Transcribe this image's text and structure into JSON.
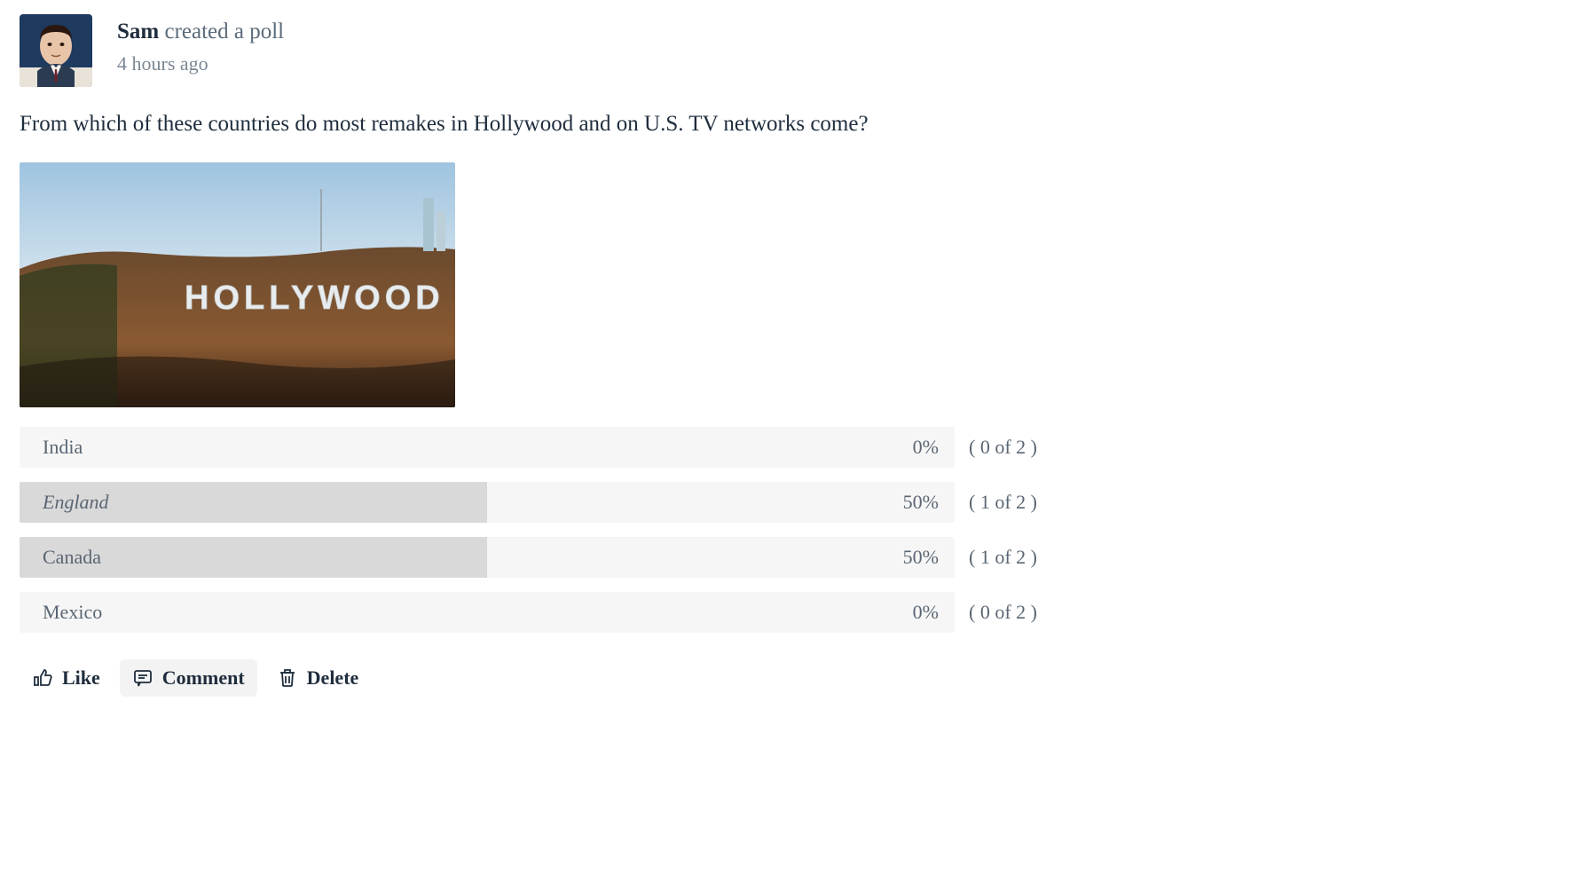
{
  "post": {
    "user": "Sam",
    "action_suffix": " created a poll",
    "timestamp": "4 hours ago",
    "question": "From which of these countries do most remakes in Hollywood and on U.S. TV networks come?",
    "image_alt": "Hollywood sign on hillside",
    "image_sign_text": "HOLLYWOOD"
  },
  "poll": {
    "total_votes": 2,
    "options": [
      {
        "label": "India",
        "votes": 0,
        "percent": "0%",
        "fill_pct": 0,
        "voted_by_me": false
      },
      {
        "label": "England",
        "votes": 1,
        "percent": "50%",
        "fill_pct": 50,
        "voted_by_me": true
      },
      {
        "label": "Canada",
        "votes": 1,
        "percent": "50%",
        "fill_pct": 50,
        "voted_by_me": false
      },
      {
        "label": "Mexico",
        "votes": 0,
        "percent": "0%",
        "fill_pct": 0,
        "voted_by_me": false
      }
    ]
  },
  "actions": {
    "like": "Like",
    "comment": "Comment",
    "delete": "Delete"
  }
}
